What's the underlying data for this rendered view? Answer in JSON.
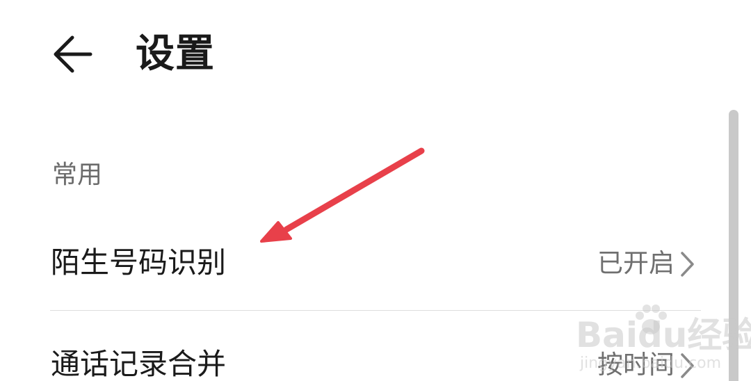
{
  "header": {
    "title": "设置",
    "back_icon": "arrow-left-icon"
  },
  "sections": [
    {
      "header": "常用",
      "items": [
        {
          "label": "陌生号码识别",
          "value": "已开启",
          "icon": "chevron-right-icon"
        },
        {
          "label": "通话记录合并",
          "value": "按时间",
          "icon": "chevron-right-icon"
        }
      ]
    }
  ],
  "annotation": {
    "icon": "red-arrow-annotation",
    "color": "#e8404a"
  },
  "watermark": {
    "brand": "Baidu经验",
    "url": "jingyan.baidu.com"
  },
  "colors": {
    "title": "#1a1a1a",
    "section_header": "#6b6b6b",
    "value": "#6f6f6f",
    "divider": "#dedede"
  }
}
